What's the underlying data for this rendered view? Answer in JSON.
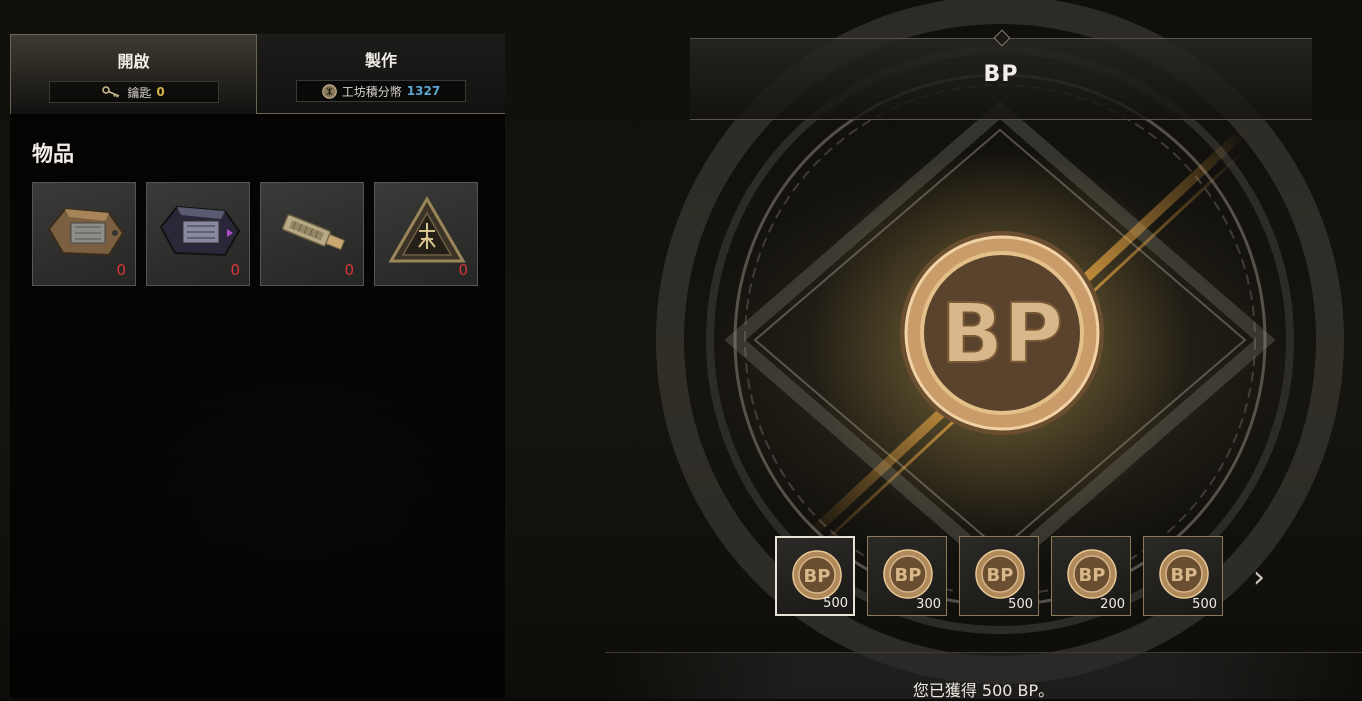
{
  "tabs": [
    {
      "title": "開啟",
      "sub_label": "鑰匙",
      "sub_value": "0",
      "icon": "key-icon"
    },
    {
      "title": "製作",
      "sub_label": "工坊積分幣",
      "sub_value": "1327",
      "icon": "workshop-coin-icon"
    }
  ],
  "items_section": {
    "heading": "物品",
    "items": [
      {
        "icon": "bronze-crate-icon",
        "count": "0"
      },
      {
        "icon": "dark-crate-icon",
        "count": "0"
      },
      {
        "icon": "brass-key-icon",
        "count": "0"
      },
      {
        "icon": "triangle-emblem-crate-icon",
        "count": "0"
      }
    ]
  },
  "reward_panel": {
    "title": "BP",
    "featured": {
      "icon": "bp-coin-icon",
      "label": "BP"
    },
    "rewards": [
      {
        "label": "BP",
        "amount": "500",
        "selected": true
      },
      {
        "label": "BP",
        "amount": "300",
        "selected": false
      },
      {
        "label": "BP",
        "amount": "500",
        "selected": false
      },
      {
        "label": "BP",
        "amount": "200",
        "selected": false
      },
      {
        "label": "BP",
        "amount": "500",
        "selected": false
      }
    ],
    "next_label": "›",
    "message": "您已獲得 500 BP。"
  },
  "colors": {
    "gold": "#d4b44a",
    "blue_currency": "#5ea5d0",
    "count_red": "#d9383a",
    "coin_bronze": "#b08a5a"
  }
}
